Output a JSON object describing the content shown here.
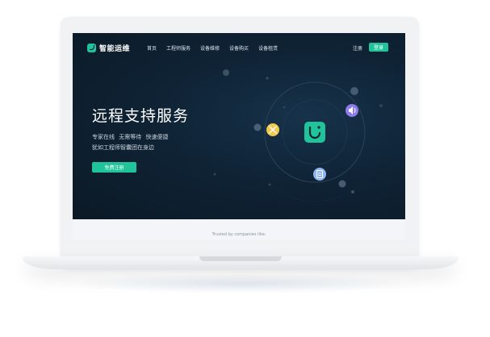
{
  "header": {
    "logo_text": "智能运维",
    "nav": [
      "首页",
      "工程师服务",
      "设备维修",
      "设备购买",
      "设备租赁"
    ],
    "register_label": "注册",
    "login_label": "登录"
  },
  "hero": {
    "title": "远程支持服务",
    "subtitle_line1": "专家在线  无需等待  快速便捷",
    "subtitle_line2": "犹如工程师智囊团在身边",
    "cta_label": "免费注册"
  },
  "footer": {
    "trusted_text": "Trusted by companies like:"
  },
  "colors": {
    "accent": "#21c49a",
    "hero_bg": "#0f2335",
    "badge_yellow": "#f2c94c",
    "badge_purple": "#8f7bea",
    "badge_blue": "#8fb6f0"
  },
  "icons": [
    "app-logo-icon",
    "center-app-icon",
    "tools-icon",
    "speaker-icon",
    "document-icon"
  ]
}
